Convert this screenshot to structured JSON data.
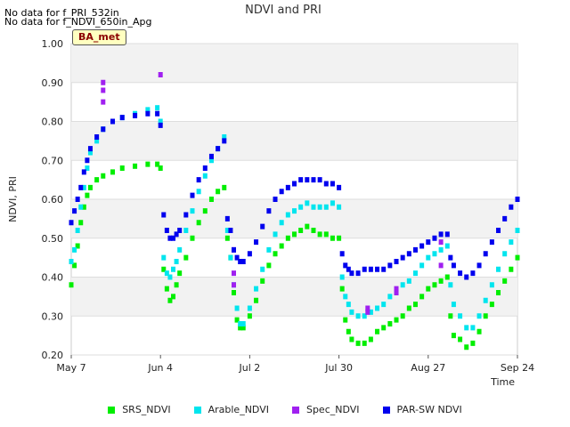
{
  "notes": [
    "No data for f_PRI_532in",
    "No data for f_NDVI_650in_Apg"
  ],
  "badge": "BA_met",
  "chart_data": {
    "type": "scatter",
    "title": "NDVI and PRI",
    "xlabel": "Time",
    "ylabel": "NDVI, PRI",
    "ylim": [
      0.2,
      1.0
    ],
    "yticks": [
      "0.20",
      "0.30",
      "0.40",
      "0.50",
      "0.60",
      "0.70",
      "0.80",
      "0.90",
      "1.00"
    ],
    "xticks": [
      {
        "label": "May 7",
        "day": 0
      },
      {
        "label": "Jun 4",
        "day": 28
      },
      {
        "label": "Jul 2",
        "day": 56
      },
      {
        "label": "Jul 30",
        "day": 84
      },
      {
        "label": "Aug 27",
        "day": 112
      },
      {
        "label": "Sep 24",
        "day": 140
      }
    ],
    "grid": true,
    "legend_position": "bottom",
    "series": [
      {
        "name": "SRS_NDVI",
        "color": "#00ee00",
        "points": [
          [
            0,
            0.38
          ],
          [
            1,
            0.43
          ],
          [
            2,
            0.48
          ],
          [
            3,
            0.54
          ],
          [
            4,
            0.58
          ],
          [
            5,
            0.61
          ],
          [
            6,
            0.63
          ],
          [
            8,
            0.65
          ],
          [
            10,
            0.66
          ],
          [
            13,
            0.67
          ],
          [
            16,
            0.68
          ],
          [
            20,
            0.685
          ],
          [
            24,
            0.69
          ],
          [
            27,
            0.69
          ],
          [
            28,
            0.68
          ],
          [
            29,
            0.42
          ],
          [
            30,
            0.37
          ],
          [
            31,
            0.34
          ],
          [
            32,
            0.35
          ],
          [
            33,
            0.38
          ],
          [
            34,
            0.41
          ],
          [
            36,
            0.45
          ],
          [
            38,
            0.5
          ],
          [
            40,
            0.54
          ],
          [
            42,
            0.57
          ],
          [
            44,
            0.6
          ],
          [
            46,
            0.62
          ],
          [
            48,
            0.63
          ],
          [
            49,
            0.5
          ],
          [
            50,
            0.45
          ],
          [
            51,
            0.36
          ],
          [
            52,
            0.29
          ],
          [
            53,
            0.27
          ],
          [
            54,
            0.27
          ],
          [
            56,
            0.3
          ],
          [
            58,
            0.34
          ],
          [
            60,
            0.39
          ],
          [
            62,
            0.43
          ],
          [
            64,
            0.46
          ],
          [
            66,
            0.48
          ],
          [
            68,
            0.5
          ],
          [
            70,
            0.51
          ],
          [
            72,
            0.52
          ],
          [
            74,
            0.53
          ],
          [
            76,
            0.52
          ],
          [
            78,
            0.51
          ],
          [
            80,
            0.51
          ],
          [
            82,
            0.5
          ],
          [
            84,
            0.5
          ],
          [
            85,
            0.37
          ],
          [
            86,
            0.29
          ],
          [
            87,
            0.26
          ],
          [
            88,
            0.24
          ],
          [
            90,
            0.23
          ],
          [
            92,
            0.23
          ],
          [
            94,
            0.24
          ],
          [
            96,
            0.26
          ],
          [
            98,
            0.27
          ],
          [
            100,
            0.28
          ],
          [
            102,
            0.29
          ],
          [
            104,
            0.3
          ],
          [
            106,
            0.32
          ],
          [
            108,
            0.33
          ],
          [
            110,
            0.35
          ],
          [
            112,
            0.37
          ],
          [
            114,
            0.38
          ],
          [
            116,
            0.39
          ],
          [
            118,
            0.4
          ],
          [
            119,
            0.3
          ],
          [
            120,
            0.25
          ],
          [
            122,
            0.24
          ],
          [
            124,
            0.22
          ],
          [
            126,
            0.23
          ],
          [
            128,
            0.26
          ],
          [
            130,
            0.3
          ],
          [
            132,
            0.33
          ],
          [
            134,
            0.36
          ],
          [
            136,
            0.39
          ],
          [
            138,
            0.42
          ],
          [
            140,
            0.45
          ]
        ]
      },
      {
        "name": "Arable_NDVI",
        "color": "#00e5ee",
        "points": [
          [
            0,
            0.44
          ],
          [
            1,
            0.47
          ],
          [
            2,
            0.52
          ],
          [
            3,
            0.58
          ],
          [
            4,
            0.63
          ],
          [
            5,
            0.68
          ],
          [
            6,
            0.72
          ],
          [
            8,
            0.75
          ],
          [
            10,
            0.78
          ],
          [
            13,
            0.8
          ],
          [
            16,
            0.81
          ],
          [
            20,
            0.82
          ],
          [
            24,
            0.83
          ],
          [
            27,
            0.835
          ],
          [
            28,
            0.8
          ],
          [
            29,
            0.45
          ],
          [
            30,
            0.41
          ],
          [
            31,
            0.4
          ],
          [
            32,
            0.42
          ],
          [
            33,
            0.44
          ],
          [
            34,
            0.47
          ],
          [
            36,
            0.52
          ],
          [
            38,
            0.57
          ],
          [
            40,
            0.62
          ],
          [
            42,
            0.66
          ],
          [
            44,
            0.7
          ],
          [
            46,
            0.73
          ],
          [
            48,
            0.76
          ],
          [
            49,
            0.52
          ],
          [
            50,
            0.45
          ],
          [
            51,
            0.38
          ],
          [
            52,
            0.32
          ],
          [
            53,
            0.28
          ],
          [
            54,
            0.28
          ],
          [
            56,
            0.32
          ],
          [
            58,
            0.37
          ],
          [
            60,
            0.42
          ],
          [
            62,
            0.47
          ],
          [
            64,
            0.51
          ],
          [
            66,
            0.54
          ],
          [
            68,
            0.56
          ],
          [
            70,
            0.57
          ],
          [
            72,
            0.58
          ],
          [
            74,
            0.59
          ],
          [
            76,
            0.58
          ],
          [
            78,
            0.58
          ],
          [
            80,
            0.58
          ],
          [
            82,
            0.59
          ],
          [
            84,
            0.58
          ],
          [
            85,
            0.4
          ],
          [
            86,
            0.35
          ],
          [
            87,
            0.33
          ],
          [
            88,
            0.31
          ],
          [
            90,
            0.3
          ],
          [
            92,
            0.3
          ],
          [
            94,
            0.31
          ],
          [
            96,
            0.32
          ],
          [
            98,
            0.33
          ],
          [
            100,
            0.35
          ],
          [
            102,
            0.36
          ],
          [
            104,
            0.38
          ],
          [
            106,
            0.39
          ],
          [
            108,
            0.41
          ],
          [
            110,
            0.43
          ],
          [
            112,
            0.45
          ],
          [
            114,
            0.46
          ],
          [
            116,
            0.47
          ],
          [
            118,
            0.48
          ],
          [
            119,
            0.38
          ],
          [
            120,
            0.33
          ],
          [
            122,
            0.3
          ],
          [
            124,
            0.27
          ],
          [
            126,
            0.27
          ],
          [
            128,
            0.3
          ],
          [
            130,
            0.34
          ],
          [
            132,
            0.38
          ],
          [
            134,
            0.42
          ],
          [
            136,
            0.46
          ],
          [
            138,
            0.49
          ],
          [
            140,
            0.52
          ]
        ]
      },
      {
        "name": "Spec_NDVI",
        "color": "#a020f0",
        "points": [
          [
            10,
            0.85
          ],
          [
            10,
            0.88
          ],
          [
            10,
            0.9
          ],
          [
            28,
            0.92
          ],
          [
            51,
            0.38
          ],
          [
            51,
            0.41
          ],
          [
            51,
            0.47
          ],
          [
            93,
            0.31
          ],
          [
            93,
            0.32
          ],
          [
            102,
            0.36
          ],
          [
            102,
            0.37
          ],
          [
            116,
            0.43
          ],
          [
            116,
            0.49
          ]
        ]
      },
      {
        "name": "PAR-SW NDVI",
        "color": "#0000ee",
        "points": [
          [
            0,
            0.54
          ],
          [
            1,
            0.57
          ],
          [
            2,
            0.6
          ],
          [
            3,
            0.63
          ],
          [
            4,
            0.67
          ],
          [
            5,
            0.7
          ],
          [
            6,
            0.73
          ],
          [
            8,
            0.76
          ],
          [
            10,
            0.78
          ],
          [
            13,
            0.8
          ],
          [
            16,
            0.81
          ],
          [
            20,
            0.815
          ],
          [
            24,
            0.82
          ],
          [
            27,
            0.82
          ],
          [
            28,
            0.79
          ],
          [
            29,
            0.56
          ],
          [
            30,
            0.52
          ],
          [
            31,
            0.5
          ],
          [
            32,
            0.5
          ],
          [
            33,
            0.51
          ],
          [
            34,
            0.52
          ],
          [
            36,
            0.56
          ],
          [
            38,
            0.61
          ],
          [
            40,
            0.65
          ],
          [
            42,
            0.68
          ],
          [
            44,
            0.71
          ],
          [
            46,
            0.73
          ],
          [
            48,
            0.75
          ],
          [
            49,
            0.55
          ],
          [
            50,
            0.52
          ],
          [
            51,
            0.47
          ],
          [
            52,
            0.45
          ],
          [
            53,
            0.44
          ],
          [
            54,
            0.44
          ],
          [
            56,
            0.46
          ],
          [
            58,
            0.49
          ],
          [
            60,
            0.53
          ],
          [
            62,
            0.57
          ],
          [
            64,
            0.6
          ],
          [
            66,
            0.62
          ],
          [
            68,
            0.63
          ],
          [
            70,
            0.64
          ],
          [
            72,
            0.65
          ],
          [
            74,
            0.65
          ],
          [
            76,
            0.65
          ],
          [
            78,
            0.65
          ],
          [
            80,
            0.64
          ],
          [
            82,
            0.64
          ],
          [
            84,
            0.63
          ],
          [
            85,
            0.46
          ],
          [
            86,
            0.43
          ],
          [
            87,
            0.42
          ],
          [
            88,
            0.41
          ],
          [
            90,
            0.41
          ],
          [
            92,
            0.42
          ],
          [
            94,
            0.42
          ],
          [
            96,
            0.42
          ],
          [
            98,
            0.42
          ],
          [
            100,
            0.43
          ],
          [
            102,
            0.44
          ],
          [
            104,
            0.45
          ],
          [
            106,
            0.46
          ],
          [
            108,
            0.47
          ],
          [
            110,
            0.48
          ],
          [
            112,
            0.49
          ],
          [
            114,
            0.5
          ],
          [
            116,
            0.51
          ],
          [
            118,
            0.51
          ],
          [
            119,
            0.45
          ],
          [
            120,
            0.43
          ],
          [
            122,
            0.41
          ],
          [
            124,
            0.4
          ],
          [
            126,
            0.41
          ],
          [
            128,
            0.43
          ],
          [
            130,
            0.46
          ],
          [
            132,
            0.49
          ],
          [
            134,
            0.52
          ],
          [
            136,
            0.55
          ],
          [
            138,
            0.58
          ],
          [
            140,
            0.6
          ]
        ]
      }
    ]
  }
}
